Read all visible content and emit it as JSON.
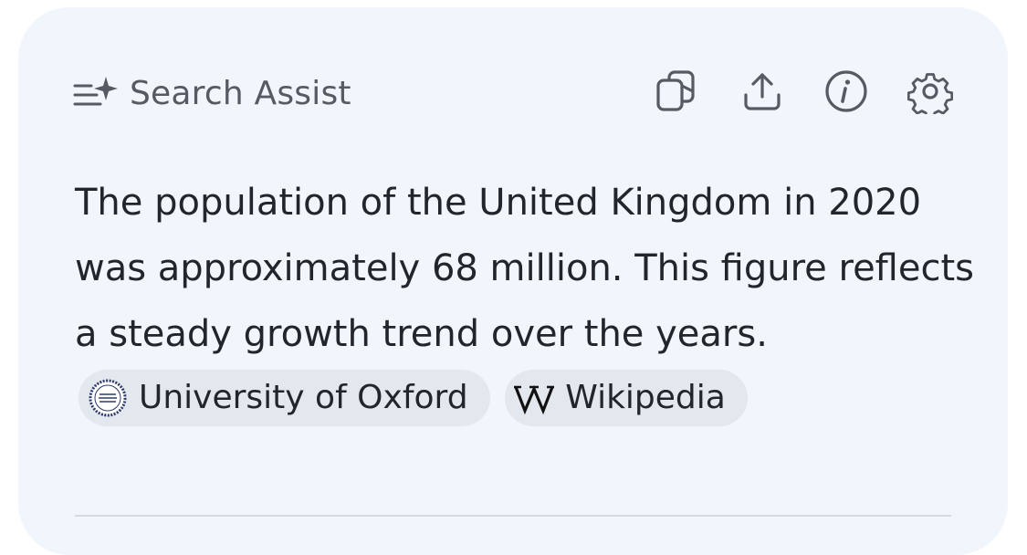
{
  "header": {
    "title": "Search Assist",
    "icon": "sparkle-list-icon"
  },
  "toolbar": {
    "buttons": [
      {
        "name": "copy-icon"
      },
      {
        "name": "share-icon"
      },
      {
        "name": "info-icon"
      },
      {
        "name": "settings-icon"
      }
    ]
  },
  "answer": {
    "text": "The population of the United Kingdom in 2020 was approximately 68 million. This figure reflects a steady growth trend over the years.",
    "sources": [
      {
        "label": "University of Oxford",
        "icon": "oxford-migration-observatory-logo"
      },
      {
        "label": "Wikipedia",
        "icon": "wikipedia-w-icon"
      }
    ]
  },
  "colors": {
    "card_bg": "#f1f5fc",
    "chip_bg": "#e3e8ef",
    "text": "#22252b",
    "muted": "#555a63"
  }
}
